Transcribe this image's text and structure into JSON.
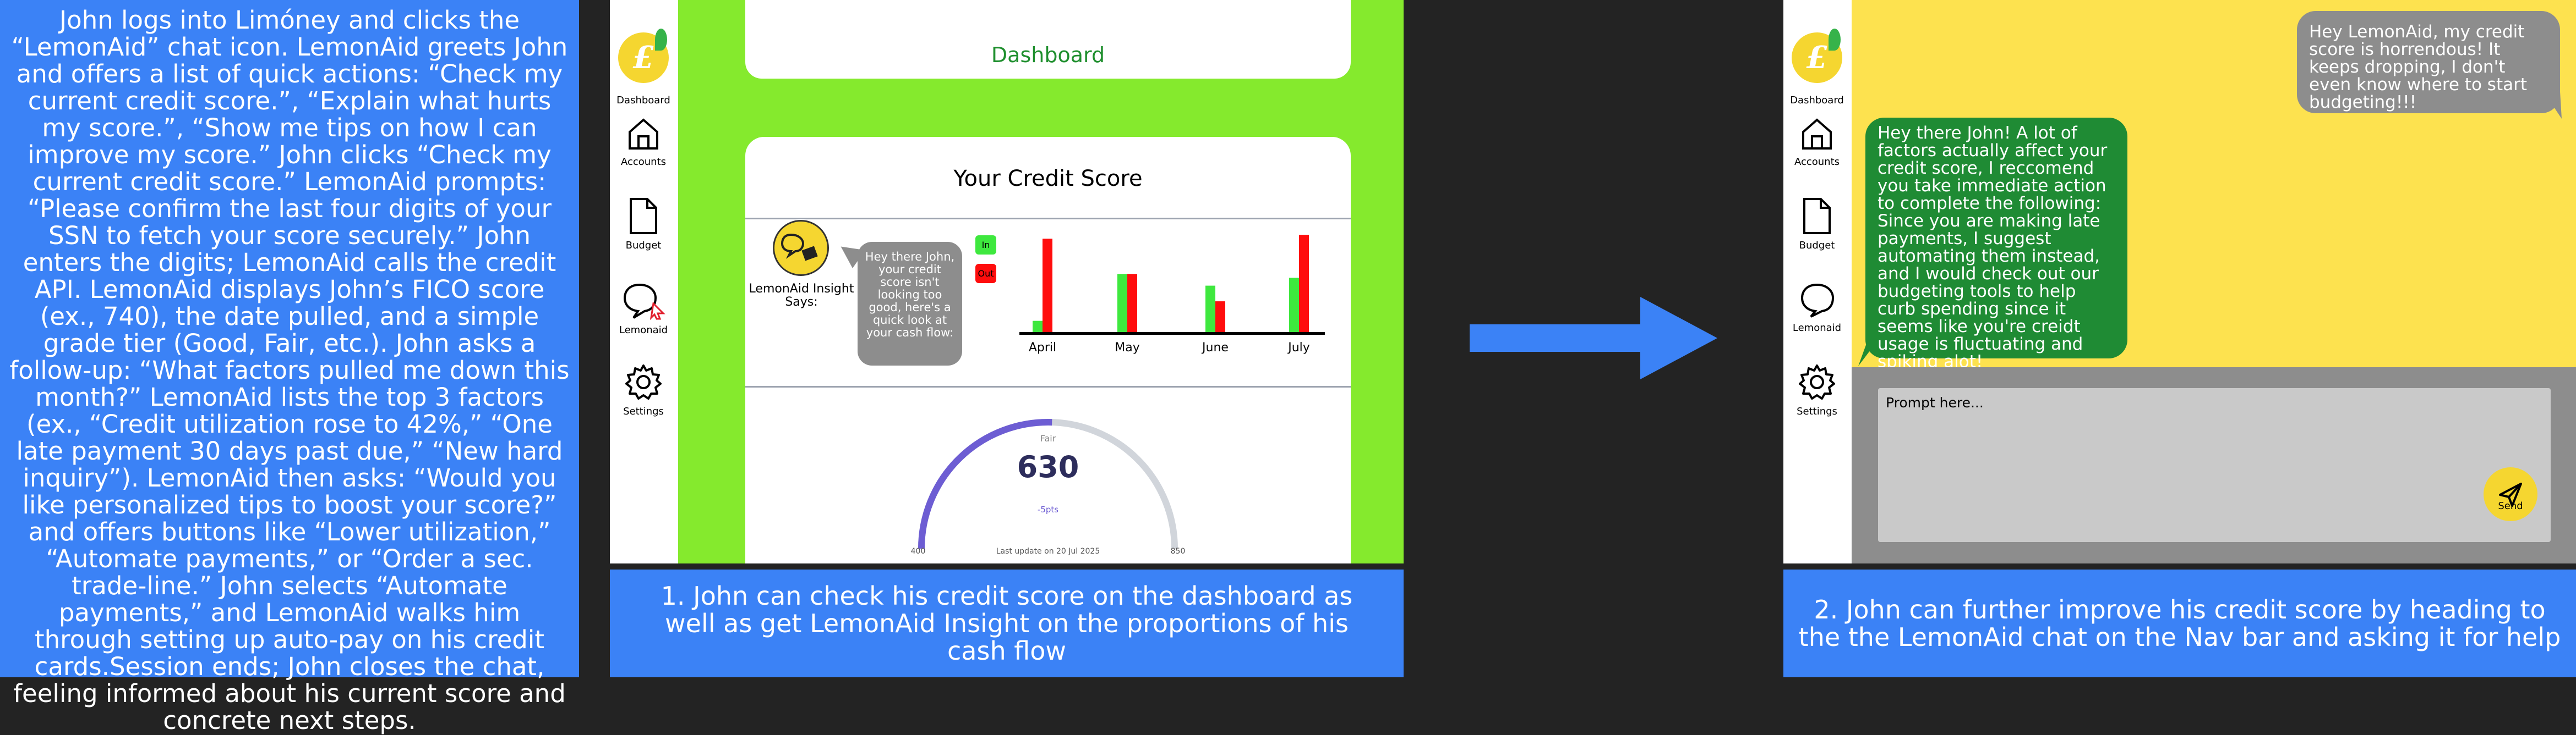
{
  "story": {
    "text": "John logs into Limóney and clicks the “LemonAid” chat icon. LemonAid greets John and offers a list of quick actions: “Check my current credit score.”, “Explain what hurts my score.”, “Show me tips on how I can improve my score.” John clicks “Check my current credit score.” LemonAid prompts: “Please confirm the last four digits of your SSN to fetch your score securely.” John enters the digits; LemonAid calls the credit API. LemonAid displays John’s FICO score (ex., 740), the date pulled, and a simple grade tier (Good, Fair, etc.). John asks a follow-up: “What factors pulled me down this month?” LemonAid lists the top 3 factors (ex., “Credit utilization rose to 42%,” “One late payment 30 days past due,” “New hard inquiry”). LemonAid then asks: “Would you like personalized tips to boost your score?” and offers buttons like “Lower utilization,” “Automate payments,” or “Order a sec. trade-line.” John selects “Automate payments,” and LemonAid walks him through setting up auto-pay on his credit cards.Session ends; John closes the chat, feeling informed about his current score and concrete next steps."
  },
  "nav": {
    "logo_letter": "£",
    "dashboard": "Dashboard",
    "accounts": "Accounts",
    "budget": "Budget",
    "lemonaid": "Lemonaid",
    "settings": "Settings"
  },
  "screen1": {
    "dashboard_title": "Dashboard",
    "score_title": "Your Credit Score",
    "insight_label": "LemonAid Insight Says:",
    "insight_bubble": "Hey there John, your credit score isn't looking too good, here's a quick look at your cash flow:",
    "legend_in": "In",
    "legend_out": "Out",
    "gauge": {
      "label": "Fair",
      "value": "630",
      "delta": "-5pts",
      "min": "400",
      "max": "850",
      "updated": "Last update on 20 Jul 2025",
      "fraction": 0.51
    },
    "caption": "1.  John can check his credit score on the dashboard as well as get LemonAid Insight on the proportions of his cash flow"
  },
  "chart_data": {
    "type": "bar",
    "categories": [
      "April",
      "May",
      "June",
      "July"
    ],
    "series": [
      {
        "name": "In",
        "values": [
          3,
          15,
          12,
          14
        ]
      },
      {
        "name": "Out",
        "values": [
          24,
          15,
          8,
          25
        ]
      }
    ],
    "ylim": [
      0,
      26
    ],
    "colors": {
      "In": "#3ee83e",
      "Out": "#ff0d0d"
    },
    "grid": false,
    "legend": "top-left"
  },
  "screen2": {
    "user_message": "Hey LemonAid, my credit score is horrendous! It keeps dropping, I don't even know where to start budgeting!!!",
    "bot_message": "Hey there John! A lot of factors actually affect your credit score, I reccomend you take immediate action to complete the following: Since you are making late payments, I suggest automating them instead, and I would check out our budgeting tools to help curb spending since it seems like you're creidt usage is fluctuating and spiking alot!",
    "prompt_placeholder": "Prompt here...",
    "send_label": "Send",
    "caption": "2.  John can further improve his credit score by heading to the the LemonAid chat on the Nav bar and asking it for help"
  },
  "colors": {
    "blue": "#3b82f6",
    "lime": "#85ea2d",
    "yellow": "#fde24f",
    "green": "#1f8b34",
    "gray": "#8d8d8d"
  }
}
